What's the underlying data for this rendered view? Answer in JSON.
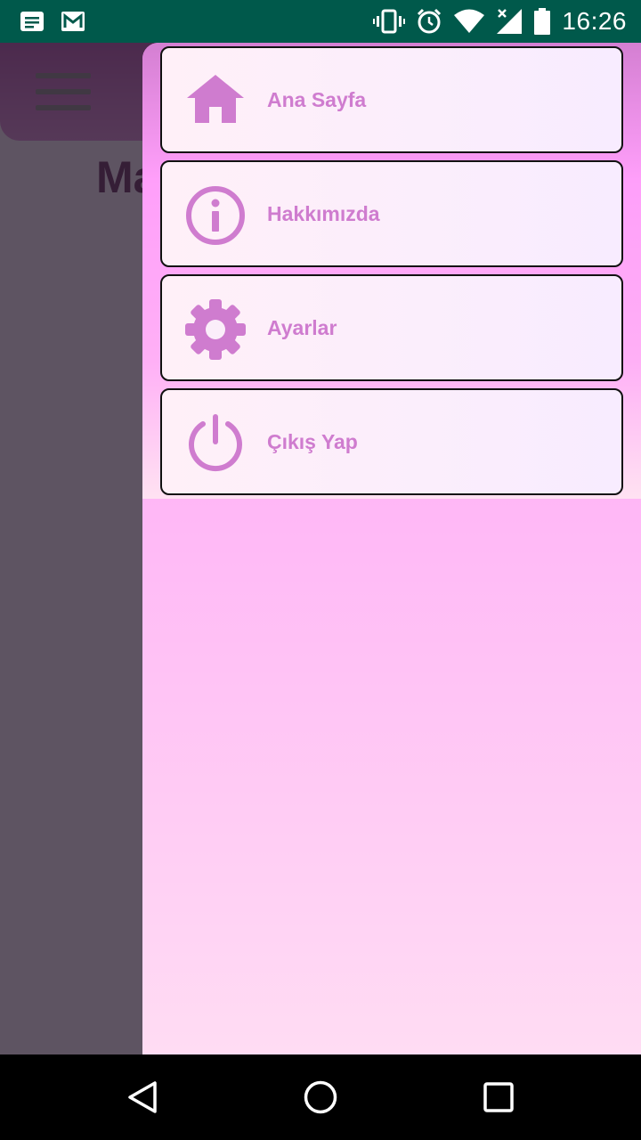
{
  "status_bar": {
    "time": "16:26",
    "left_icons": [
      "notes-icon",
      "gmail-icon"
    ],
    "right_icons": [
      "vibrate-icon",
      "alarm-icon",
      "wifi-icon",
      "signal-icon",
      "battery-icon"
    ]
  },
  "app": {
    "heading_fragment": "Ma"
  },
  "drawer": {
    "items": [
      {
        "label": "Ana Sayfa",
        "icon": "home-icon"
      },
      {
        "label": "Hakkımızda",
        "icon": "info-icon"
      },
      {
        "label": "Ayarlar",
        "icon": "gear-icon"
      },
      {
        "label": "Çıkış Yap",
        "icon": "power-icon"
      }
    ]
  },
  "colors": {
    "status_bar": "#00594b",
    "drawer_pink": "#ff9ffa",
    "item_text": "#cf7ccf",
    "icon": "#cf7ccf"
  },
  "nav_bar": {
    "buttons": [
      "back-icon",
      "home-circle-icon",
      "recents-icon"
    ]
  }
}
